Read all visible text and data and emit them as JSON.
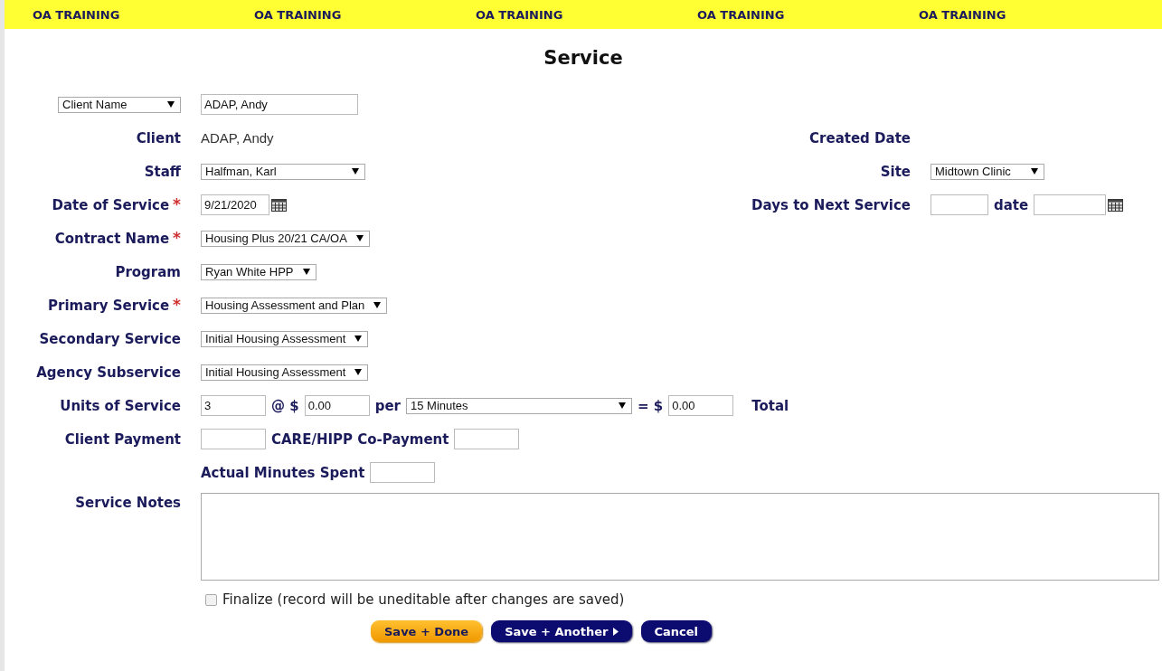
{
  "banner": [
    "OA TRAINING",
    "OA TRAINING",
    "OA TRAINING",
    "OA TRAINING",
    "OA TRAINING"
  ],
  "title": "Service",
  "lookup": {
    "selector": "Client Name",
    "value": "ADAP, Andy"
  },
  "rows": [
    {
      "kind": "text",
      "label": "Client",
      "value": "ADAP, Andy",
      "side": {
        "kind": "none",
        "label": "Created Date"
      }
    },
    {
      "kind": "select",
      "label": "Staff",
      "value": "Halfman, Karl",
      "side": {
        "kind": "select",
        "label": "Site",
        "value": "Midtown Clinic"
      }
    },
    {
      "kind": "date",
      "label": "Date of Service",
      "required_mark": "*",
      "value": "9/21/2020",
      "side": {
        "kind": "next-date",
        "label": "Days to Next Service",
        "date_label": "date"
      }
    },
    {
      "kind": "select",
      "label": "Contract Name",
      "required_mark": "*",
      "value": "Housing Plus 20/21 CA/OA"
    },
    {
      "kind": "select",
      "label": "Program",
      "value": "Ryan White HPP"
    },
    {
      "kind": "select",
      "label": "Primary Service",
      "required_mark": "*",
      "value": "Housing Assessment and Plan"
    },
    {
      "kind": "select",
      "label": "Secondary Service",
      "value": "Initial Housing Assessment"
    },
    {
      "kind": "select",
      "label": "Agency Subservice",
      "value": "Initial Housing Assessment"
    },
    {
      "kind": "units",
      "label": "Units of Service",
      "value": "3",
      "rate_prefix": "@ $",
      "rate": "0.00",
      "per_label": "per",
      "per": "15 Minutes",
      "equals": "= $",
      "total": "0.00",
      "total_label": "Total"
    },
    {
      "kind": "payment",
      "label": "Client Payment",
      "copay_label": "CARE/HIPP Co-Payment"
    },
    {
      "kind": "minutes",
      "label": "Actual Minutes Spent"
    },
    {
      "kind": "notes",
      "label": "Service Notes"
    }
  ],
  "finalize": {
    "label": "Finalize (record will be uneditable after changes are saved)",
    "checked": false
  },
  "buttons": [
    {
      "label": "Save + Done",
      "kind": "primary"
    },
    {
      "label": "Save + Another",
      "kind": "next"
    },
    {
      "label": "Cancel",
      "kind": "secondary"
    }
  ]
}
